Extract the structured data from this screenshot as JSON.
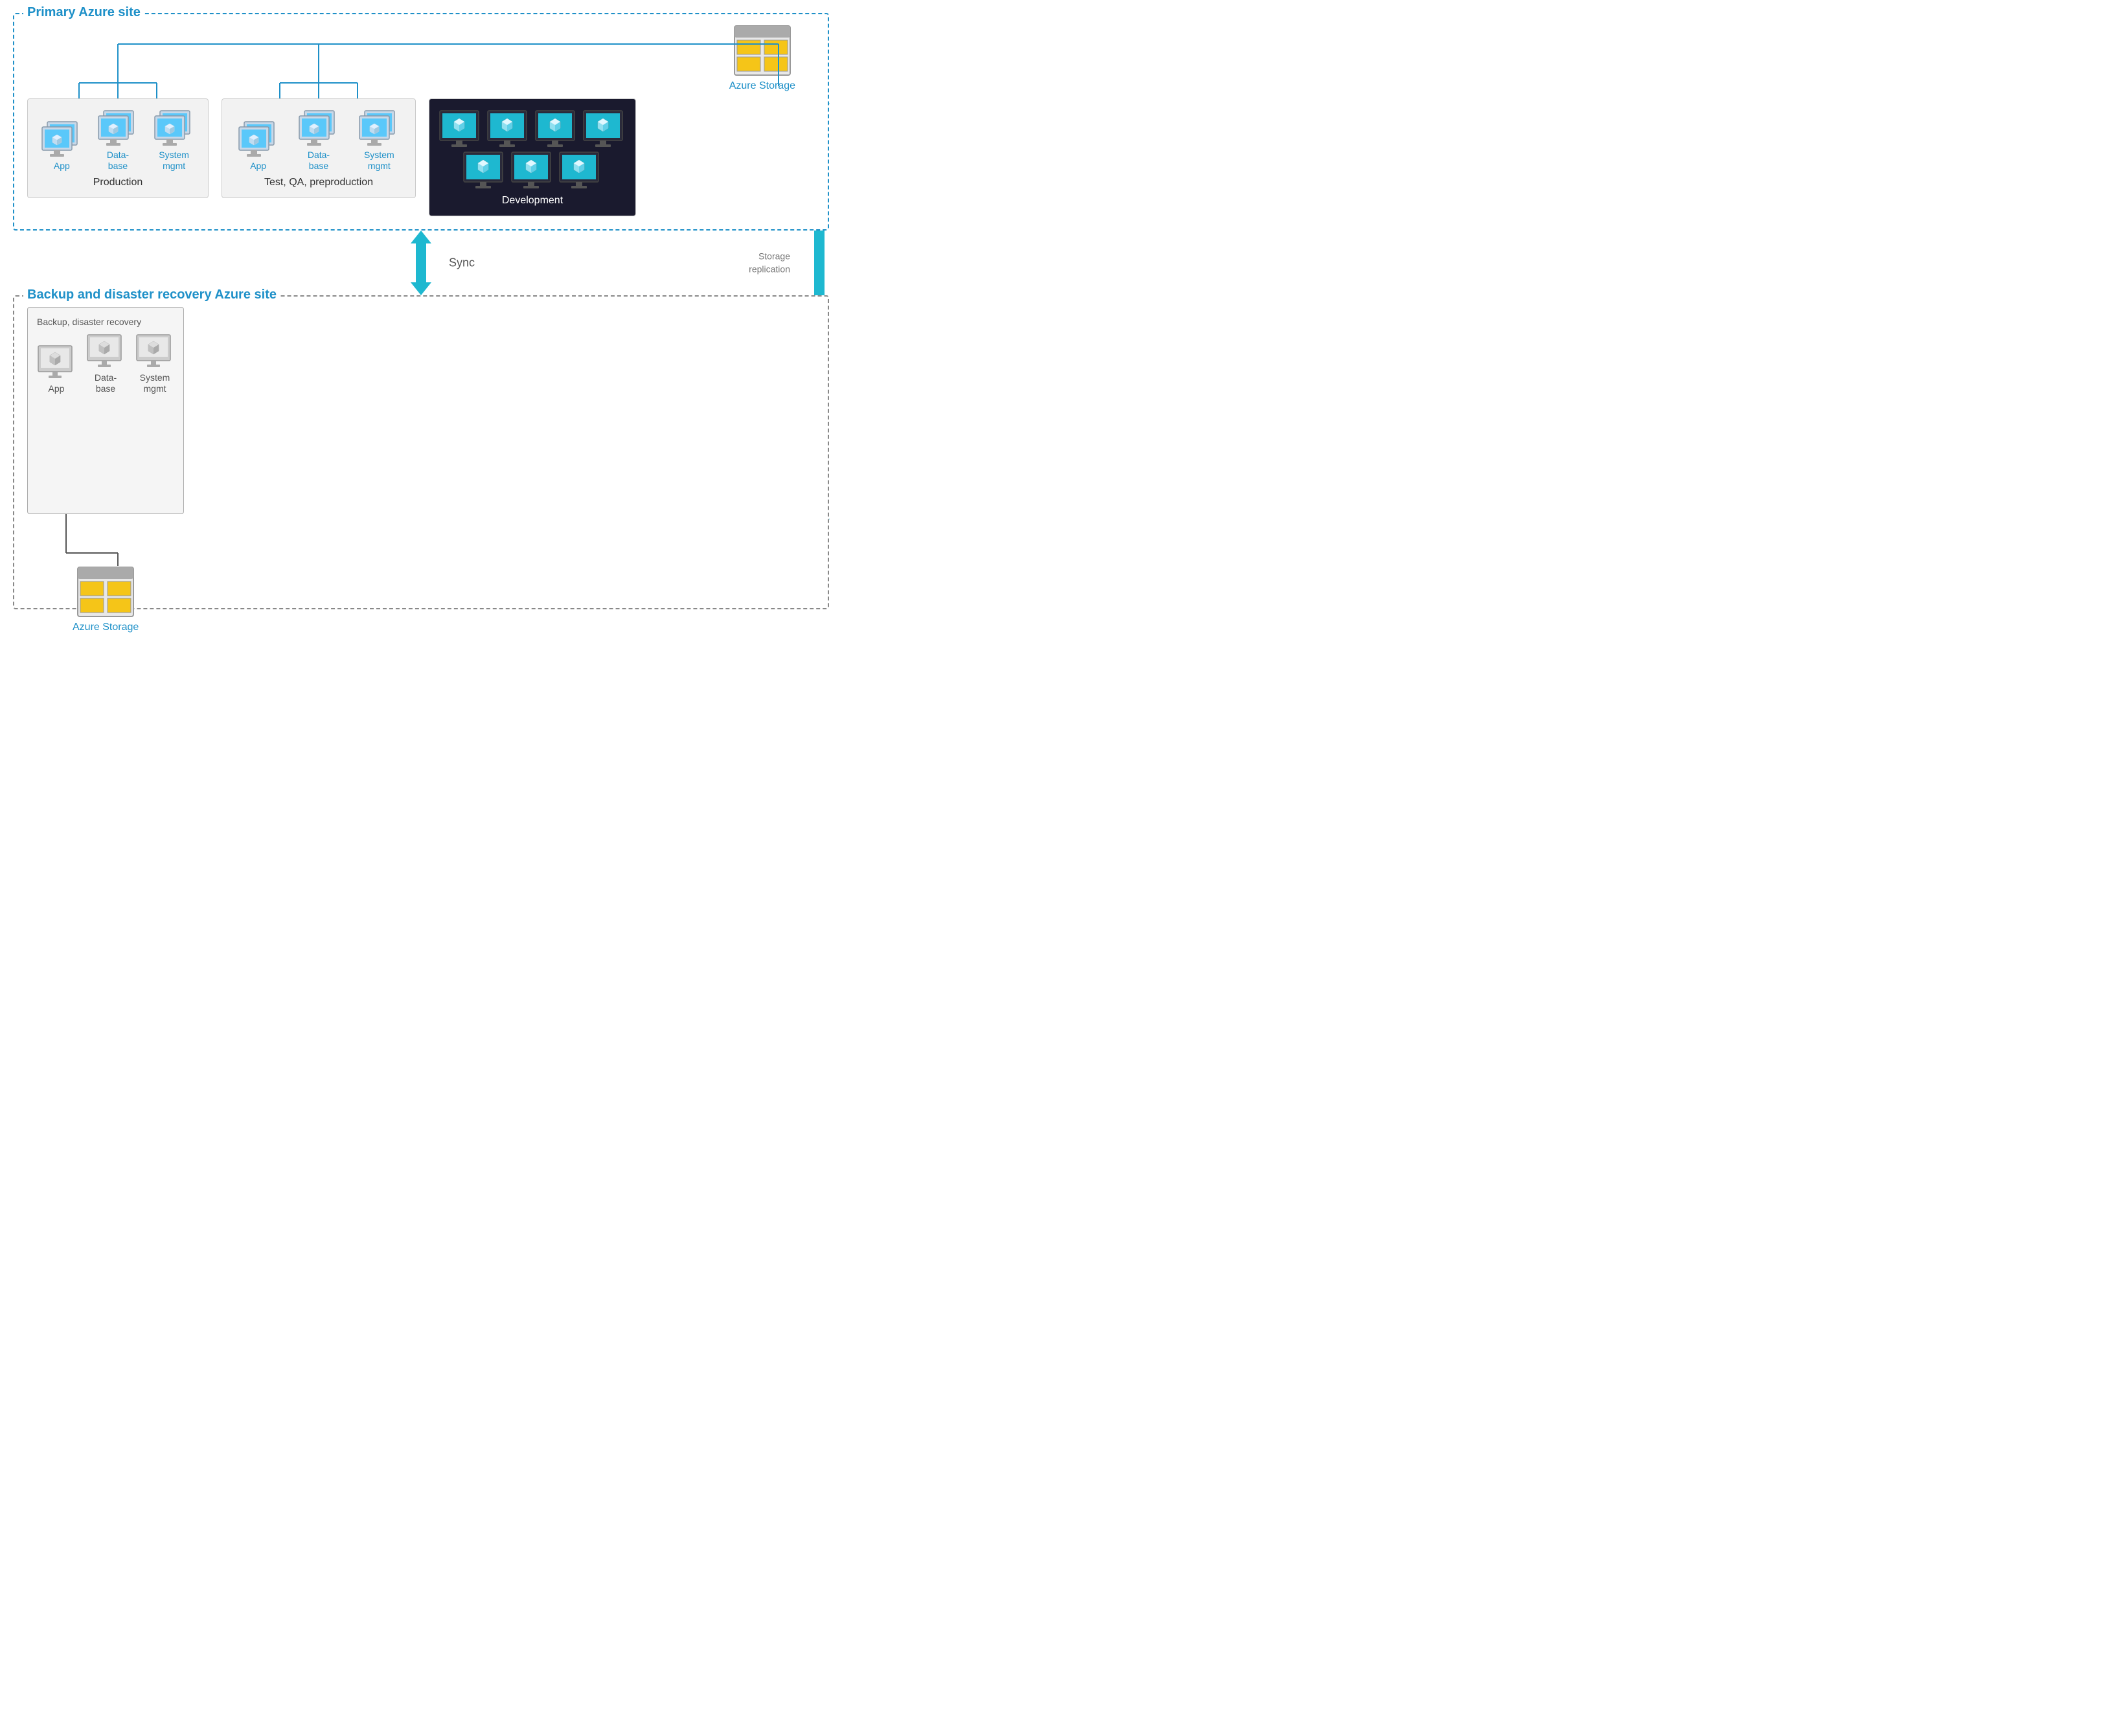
{
  "primary_site": {
    "label": "Primary Azure site",
    "storage_label": "Azure Storage",
    "groups": [
      {
        "id": "production",
        "label": "Production",
        "clusters": [
          {
            "label": "App",
            "count": 3
          },
          {
            "label": "Data-\nbase",
            "count": 3
          },
          {
            "label": "System\nmgmt",
            "count": 3
          }
        ]
      },
      {
        "id": "testqa",
        "label": "Test, QA, preproduction",
        "clusters": [
          {
            "label": "App",
            "count": 3
          },
          {
            "label": "Data-\nbase",
            "count": 3
          },
          {
            "label": "System\nmgmt",
            "count": 3
          }
        ]
      },
      {
        "id": "development",
        "label": "Development",
        "dev_top_count": 4,
        "dev_bottom_count": 3
      }
    ]
  },
  "sync": {
    "label": "Sync",
    "storage_replication_label": "Storage\nreplication"
  },
  "backup_site": {
    "label": "Backup and disaster recovery Azure site",
    "box_label": "Backup, disaster recovery",
    "storage_label": "Azure Storage",
    "clusters": [
      {
        "label": "App"
      },
      {
        "label": "Data-\nbase"
      },
      {
        "label": "System\nmgmt"
      }
    ]
  }
}
